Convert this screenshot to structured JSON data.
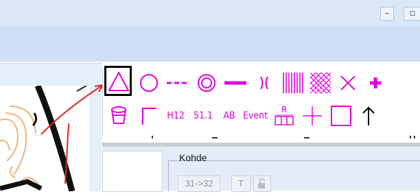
{
  "window": {
    "minimize_glyph": "–",
    "restore_glyph": "▫"
  },
  "palette": {
    "row2_labels": [
      "H12",
      "51.1",
      "AB",
      "Event"
    ],
    "symbol_color": "#e000e0"
  },
  "properties": {
    "title": "Kohde",
    "buttons": {
      "renumber": "31->32",
      "text": "T"
    }
  },
  "icons": [
    "triangle-icon",
    "circle-icon",
    "dashed-line-icon",
    "double-circle-icon",
    "thick-line-icon",
    "crossing-icon",
    "hatched-area-icon",
    "crosshatch-icon",
    "cross-icon",
    "plus-icon",
    "cup-icon",
    "corner-icon",
    "label-r-icon",
    "line-cross-icon",
    "square-icon",
    "arrow-up-icon",
    "lock-icon"
  ]
}
